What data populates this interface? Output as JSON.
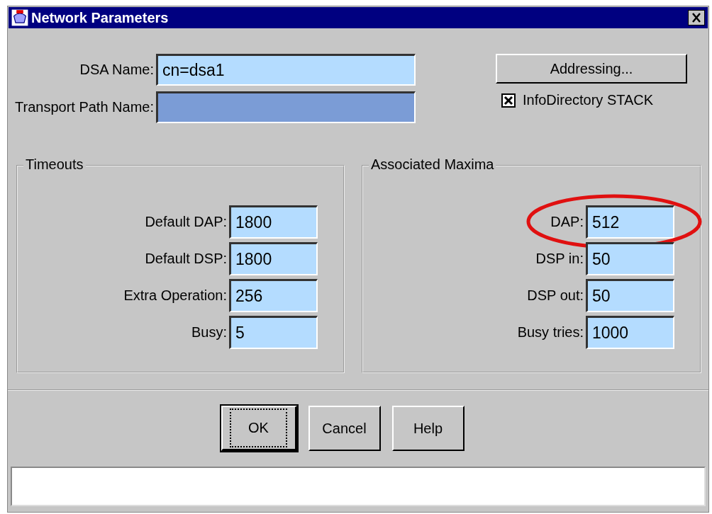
{
  "window": {
    "title": "Network Parameters"
  },
  "fields": [
    {
      "label": "DSA Name:",
      "value": "cn=dsa1",
      "focused": false
    },
    {
      "label": "Transport Path Name:",
      "focused": true
    }
  ],
  "addressing_button": "Addressing...",
  "stack_checkbox": {
    "label": "InfoDirectory STACK",
    "checked": true
  },
  "groups": [
    {
      "title": "Timeouts",
      "fields": [
        {
          "label": "Default DAP:",
          "value": "1800",
          "highlighted": false
        },
        {
          "label": "Default DSP:",
          "value": "1800",
          "highlighted": false
        },
        {
          "label": "Extra Operation:",
          "value": "256",
          "highlighted": false
        },
        {
          "label": "Busy:",
          "value": "5",
          "highlighted": false
        }
      ]
    },
    {
      "title": "Associated Maxima",
      "fields": [
        {
          "label": "DAP:",
          "value": "512",
          "highlighted": true
        },
        {
          "label": "DSP in:",
          "value": "50",
          "highlighted": false
        },
        {
          "label": "DSP out:",
          "value": "50",
          "highlighted": false
        },
        {
          "label": "Busy tries:",
          "value": "1000",
          "highlighted": false
        }
      ]
    }
  ],
  "buttons": [
    {
      "label": "OK",
      "default": true
    },
    {
      "label": "Cancel",
      "default": false
    },
    {
      "label": "Help",
      "default": false
    }
  ]
}
